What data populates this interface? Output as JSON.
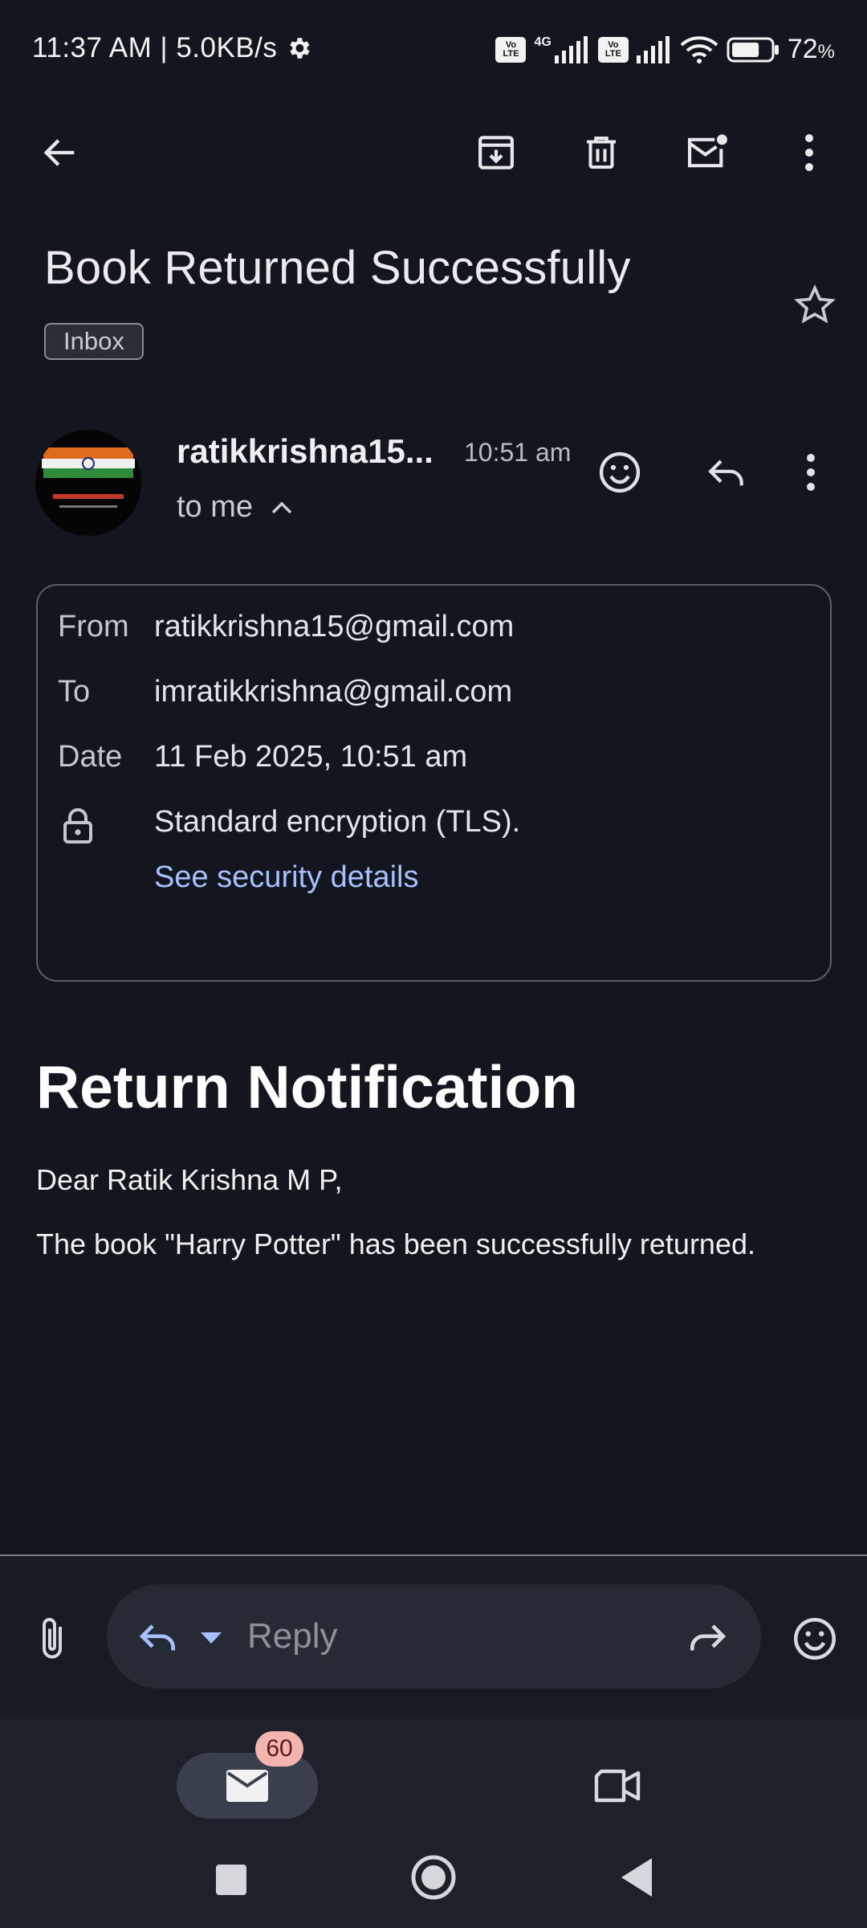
{
  "status_bar": {
    "time_speed": "11:37 AM | 5.0KB/s",
    "network_label": "4G",
    "volte_label_top": "Vo",
    "volte_label_bottom": "LTE",
    "battery_percent": "72",
    "battery_unit": "%",
    "battery_level": 0.72
  },
  "email": {
    "subject": "Book Returned Successfully",
    "label": "Inbox",
    "sender_display": "ratikkrishna15...",
    "time": "10:51 am",
    "recipient_summary": "to me"
  },
  "details": {
    "from_label": "From",
    "from_value": "ratikkrishna15@gmail.com",
    "to_label": "To",
    "to_value": "imratikkrishna@gmail.com",
    "date_label": "Date",
    "date_value": "11 Feb 2025, 10:51 am",
    "encryption_text": "Standard encryption (TLS).",
    "security_link": "See security details"
  },
  "body": {
    "heading": "Return Notification",
    "greeting": "Dear Ratik Krishna M P,",
    "message": "The book \"Harry Potter\" has been successfully returned."
  },
  "reply_bar": {
    "placeholder": "Reply"
  },
  "bottom_nav": {
    "mail_badge": "60"
  },
  "icons": {
    "toolbar": [
      "back-arrow-icon",
      "archive-icon",
      "delete-icon",
      "mark-unread-icon",
      "more-vert-icon"
    ],
    "sender_actions": [
      "emoji-react-icon",
      "reply-icon",
      "more-vert-icon"
    ],
    "reply_bar": [
      "attach-icon",
      "reply-icon",
      "dropdown-icon",
      "forward-icon",
      "emoji-icon"
    ],
    "nav": [
      "mail-icon",
      "video-icon"
    ],
    "system_nav": [
      "recents-square-icon",
      "home-circle-icon",
      "back-triangle-icon"
    ]
  },
  "colors": {
    "background": "#14161f",
    "link": "#a8c0ff",
    "badge": "#f3b4b0",
    "accent_icon": "#a8c0ff"
  }
}
